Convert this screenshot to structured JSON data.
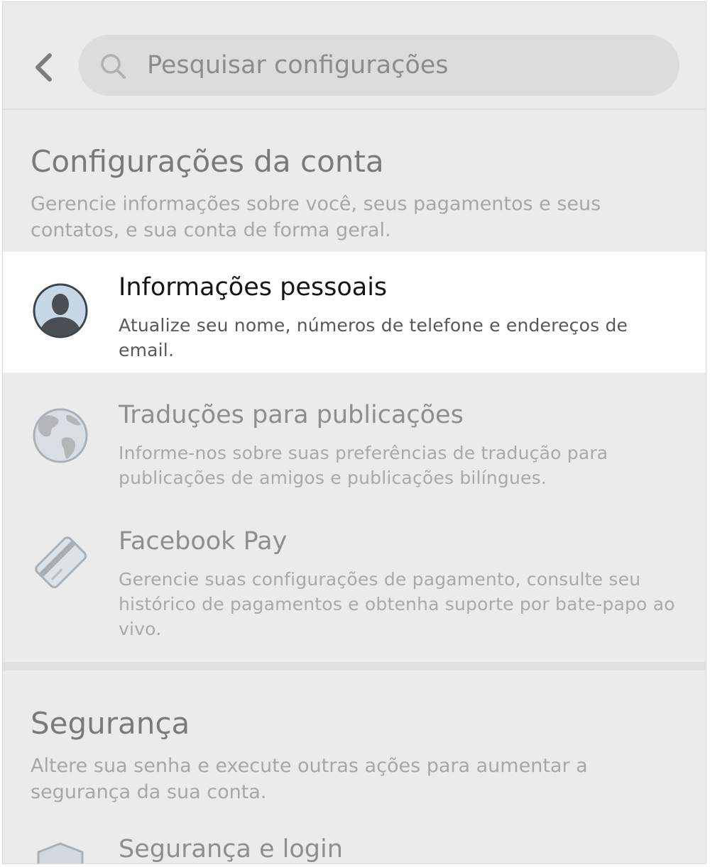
{
  "search": {
    "placeholder": "Pesquisar configurações"
  },
  "account_section": {
    "title": "Configurações da conta",
    "description": "Gerencie informações sobre você, seus pagamentos e seus contatos, e sua conta de forma geral.",
    "items": [
      {
        "title": "Informações pessoais",
        "description": "Atualize seu nome, números de telefone e endereços de email.",
        "icon": "person-icon"
      },
      {
        "title": "Traduções para publicações",
        "description": "Informe-nos sobre suas preferências de tradução para publicações de amigos e publicações bilíngues.",
        "icon": "globe-icon"
      },
      {
        "title": "Facebook Pay",
        "description": "Gerencie suas configurações de pagamento, consulte seu histórico de pagamentos e obtenha suporte por bate-papo ao vivo.",
        "icon": "credit-card-icon"
      }
    ]
  },
  "security_section": {
    "title": "Segurança",
    "description": "Altere sua senha e execute outras ações para aumentar a segurança da sua conta.",
    "items": [
      {
        "title": "Segurança e login",
        "icon": "shield-icon"
      }
    ]
  }
}
